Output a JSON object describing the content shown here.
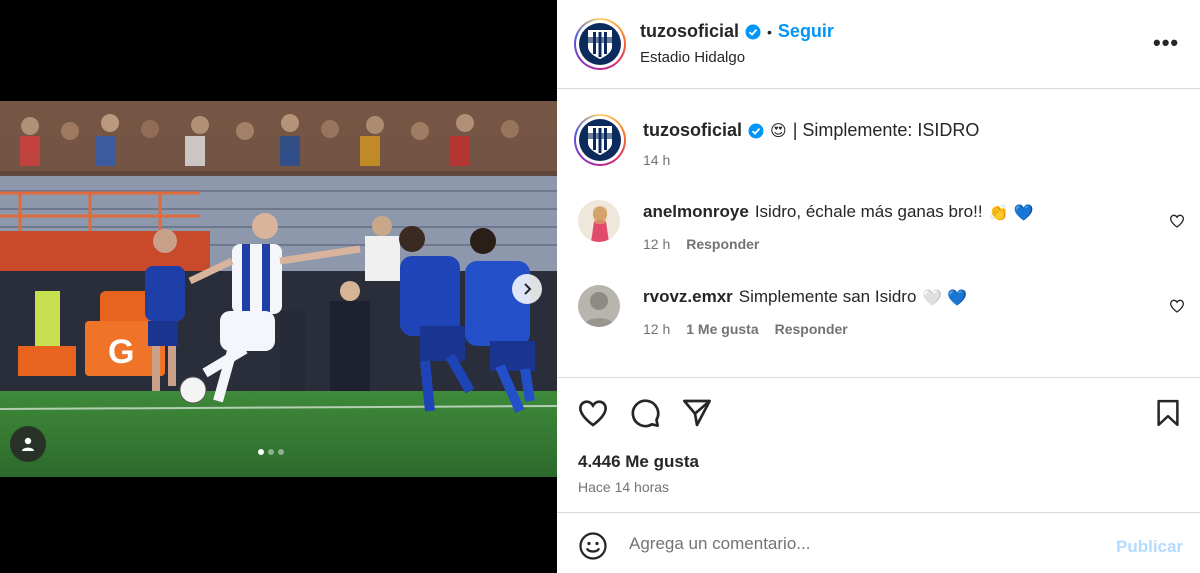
{
  "post": {
    "username": "tuzosoficial",
    "separator": "•",
    "follow_label": "Seguir",
    "location": "Estadio Hidalgo",
    "more_label": "•••"
  },
  "caption": {
    "username": "tuzosoficial",
    "emoji": "😍",
    "text": "| Simplemente: ISIDRO",
    "time": "14 h"
  },
  "comments": [
    {
      "username": "anelmonroye",
      "text": "Isidro, échale más ganas bro!!",
      "emojis": "👏 💙",
      "time": "12 h",
      "likes": "",
      "reply_label": "Responder"
    },
    {
      "username": "rvovz.emxr",
      "text": "Simplemente san Isidro",
      "emojis": "🤍 💙",
      "time": "12 h",
      "likes": "1 Me gusta",
      "reply_label": "Responder"
    }
  ],
  "stats": {
    "likes": "4.446 Me gusta",
    "posted": "Hace 14 horas"
  },
  "composer": {
    "placeholder": "Agrega un comentario...",
    "publish_label": "Publicar"
  },
  "carousel": {
    "current": 1,
    "total": 3
  },
  "colors": {
    "accent": "#0095f6",
    "publish_disabled": "#b3dbff",
    "muted": "#737373"
  }
}
